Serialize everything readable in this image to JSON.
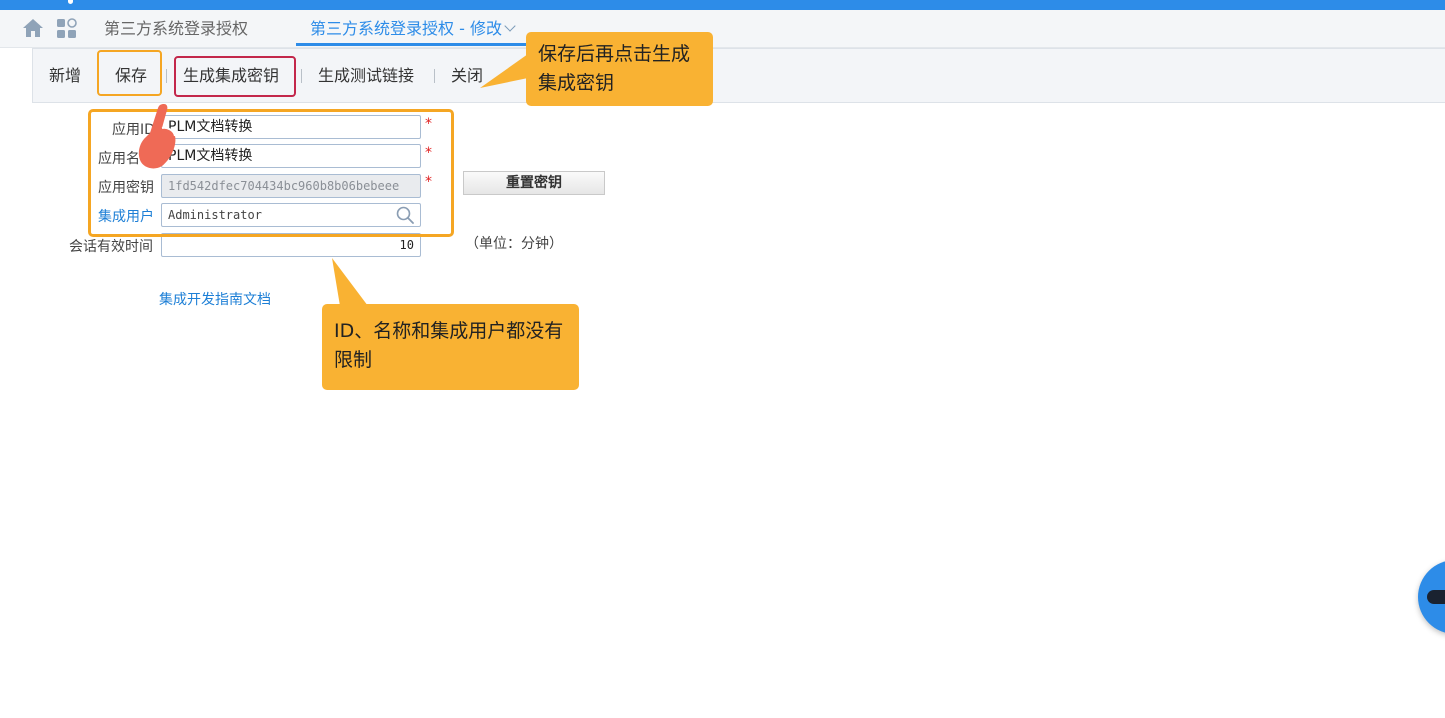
{
  "tabs": {
    "tab1_label": "第三方系统登录授权",
    "tab2_label": "第三方系统登录授权 - 修改"
  },
  "toolbar": {
    "new_label": "新增",
    "save_label": "保存",
    "generate_key_label": "生成集成密钥",
    "generate_test_link_label": "生成测试链接",
    "close_label": "关闭"
  },
  "form": {
    "app_id_label": "应用ID",
    "app_id_value": "PLM文档转换",
    "app_name_label": "应用名称",
    "app_name_value": "PLM文档转换",
    "app_secret_label": "应用密钥",
    "app_secret_value": "1fd542dfec704434bc960b8b06bebeee",
    "integration_user_label": "集成用户",
    "integration_user_value": "Administrator",
    "session_timeout_label": "会话有效时间",
    "session_timeout_value": "10",
    "required_mark": "*",
    "unit_label": "（单位：分钟）"
  },
  "reset_key_label": "重置密钥",
  "doc_link_label": "集成开发指南文档",
  "annotations": {
    "callout_save": "保存后再点击生成集成密钥",
    "callout_limits": "ID、名称和集成用户都没有限制"
  },
  "colors": {
    "primary": "#2d8ce8",
    "callout": "#f9b233",
    "highlight_orange": "#f5a623",
    "highlight_red": "#c3274b",
    "required": "#e02020",
    "link": "#1d7fd6"
  },
  "icons": [
    "home-icon",
    "apps-icon",
    "chevron-down-icon",
    "search-icon",
    "pointing-hand-icon"
  ]
}
